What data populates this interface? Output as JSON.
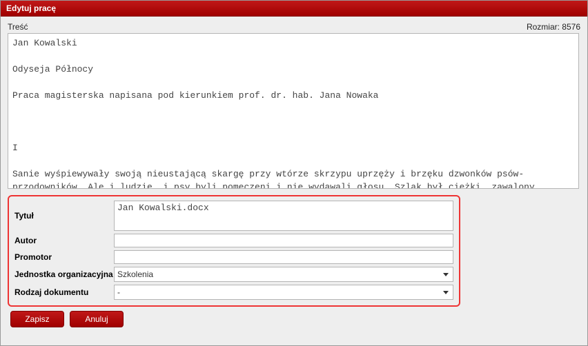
{
  "window": {
    "title": "Edytuj pracę"
  },
  "top": {
    "content_label": "Treść",
    "size_label": "Rozmiar: 8576"
  },
  "main_text": "Jan Kowalski\n\nOdyseja Północy\n\nPraca magisterska napisana pod kierunkiem prof. dr. hab. Jana Nowaka\n\n\n\nI\n\nSanie wyśpiewywały swoją nieustającą skargę przy wtórze skrzypu uprzęży i brzęku dzwonków psów-przodowników. Ale i ludzie, i psy byli pomęczeni i nie wydawali głosu. Szlak był ciężki, zawalony świeżym śniegiem; mieli za sobą daleką drogę, a płozy, obciążone zamarzniętymi na krzemień",
  "form": {
    "title_label": "Tytuł",
    "title_value": "Jan Kowalski.docx",
    "author_label": "Autor",
    "author_value": "",
    "supervisor_label": "Promotor",
    "supervisor_value": "",
    "unit_label": "Jednostka organizacyjna",
    "unit_value": "Szkolenia",
    "doctype_label": "Rodzaj dokumentu",
    "doctype_value": "-"
  },
  "buttons": {
    "save": "Zapisz",
    "cancel": "Anuluj"
  }
}
